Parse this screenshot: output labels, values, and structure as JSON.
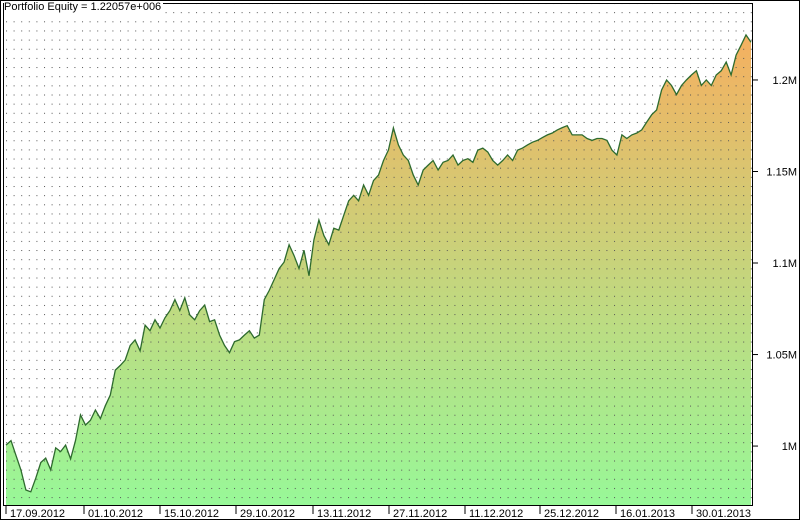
{
  "chart_data": {
    "type": "area",
    "title": "Portfolio Equity = 1.22057e+006",
    "xlabel": "",
    "ylabel": "",
    "ylim": [
      967800,
      1241500
    ],
    "grid": true,
    "y_ticks": [
      {
        "value": 1000000,
        "label": "1M"
      },
      {
        "value": 1050000,
        "label": "1.05M"
      },
      {
        "value": 1100000,
        "label": "1.1M"
      },
      {
        "value": 1150000,
        "label": "1.15M"
      },
      {
        "value": 1200000,
        "label": "1.2M"
      }
    ],
    "x_ticks": [
      "17.09.2012",
      "01.10.2012",
      "15.10.2012",
      "29.10.2012",
      "13.11.2012",
      "27.11.2012",
      "11.12.2012",
      "25.12.2012",
      "16.01.2013",
      "30.01.2013"
    ],
    "series": [
      {
        "name": "Portfolio Equity",
        "line_color": "#2e6b2e",
        "fill_top_color": "#f5b060",
        "fill_bottom_color": "#98f898",
        "values": [
          1000.5,
          1003,
          995,
          987,
          976,
          975,
          982.5,
          991,
          993.4,
          987,
          999,
          997,
          1000.5,
          993,
          1003,
          1017,
          1011.5,
          1014,
          1019.7,
          1015,
          1022,
          1027.9,
          1041.5,
          1044,
          1047,
          1055,
          1058,
          1052,
          1066,
          1063,
          1069,
          1064.5,
          1070,
          1074,
          1080,
          1074,
          1081,
          1071.6,
          1069,
          1074,
          1077,
          1068,
          1069,
          1060.6,
          1055,
          1051,
          1057,
          1058,
          1060.6,
          1063,
          1059,
          1060.6,
          1080,
          1085,
          1091,
          1097,
          1100.5,
          1110,
          1104,
          1097,
          1107,
          1093,
          1112.6,
          1123.5,
          1115,
          1110,
          1119,
          1118,
          1126,
          1134,
          1137,
          1134,
          1142.6,
          1137,
          1145,
          1148,
          1156,
          1161.7,
          1173.8,
          1164.5,
          1159,
          1156,
          1148,
          1142.6,
          1150.8,
          1153.5,
          1156,
          1150.8,
          1155,
          1156,
          1159,
          1153.5,
          1156,
          1157,
          1155,
          1161.7,
          1162.8,
          1160.6,
          1156,
          1153.5,
          1156,
          1159,
          1156,
          1161.7,
          1162.8,
          1164.5,
          1166,
          1167,
          1168.5,
          1170,
          1171,
          1172.7,
          1174,
          1175,
          1170,
          1170,
          1170,
          1168,
          1167,
          1168,
          1168,
          1167,
          1161.7,
          1159,
          1170,
          1168,
          1170,
          1171,
          1172.7,
          1177,
          1181,
          1183.6,
          1194.5,
          1200,
          1197,
          1192,
          1197,
          1200,
          1202.7,
          1205,
          1197,
          1200,
          1197,
          1202.7,
          1205,
          1209.8,
          1202.7,
          1213.6,
          1219,
          1224.6,
          1220.6
        ],
        "value_unit": "thousands"
      }
    ]
  }
}
